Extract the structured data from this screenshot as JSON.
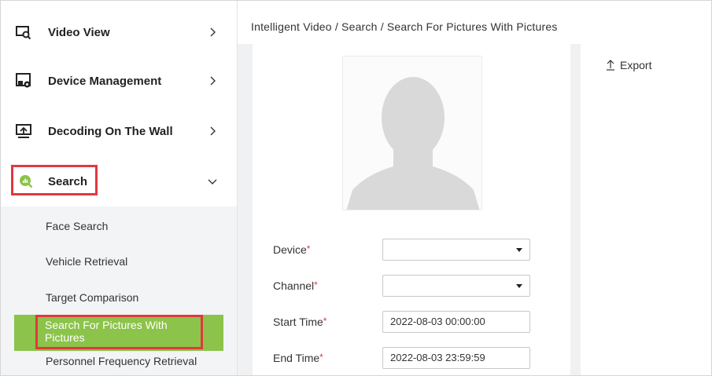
{
  "sidebar": {
    "items": [
      {
        "label": "Video View",
        "icon": "video-view-icon"
      },
      {
        "label": "Device Management",
        "icon": "device-management-icon"
      },
      {
        "label": "Decoding On The Wall",
        "icon": "decoding-wall-icon"
      },
      {
        "label": "Search",
        "icon": "search-icon"
      }
    ],
    "submenu": [
      {
        "label": "Face Search"
      },
      {
        "label": "Vehicle Retrieval"
      },
      {
        "label": "Target Comparison"
      },
      {
        "label": "Search For Pictures With Pictures"
      },
      {
        "label": "Personnel Frequency Retrieval"
      }
    ]
  },
  "breadcrumb": "Intelligent Video / Search / Search For Pictures With Pictures",
  "form": {
    "device_label": "Device",
    "channel_label": "Channel",
    "start_time_label": "Start Time",
    "end_time_label": "End Time",
    "required_mark": "*",
    "device_value": "",
    "channel_value": "",
    "start_time_value": "2022-08-03 00:00:00",
    "end_time_value": "2022-08-03 23:59:59"
  },
  "toolbar": {
    "export_label": "Export",
    "export_icon": "upload-icon"
  },
  "colors": {
    "accent_green": "#8cc34a",
    "highlight_red": "#e2383f",
    "required_red": "#e2383f"
  }
}
